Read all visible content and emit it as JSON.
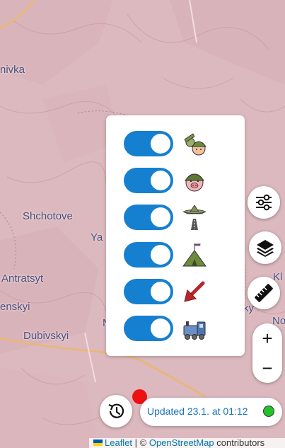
{
  "map": {
    "places": [
      "nivka",
      "Shchotove",
      "Ya",
      "Antratsyt",
      "enskyi",
      "Dubivskyi",
      "N",
      "Kl",
      "ky",
      "No"
    ]
  },
  "layer_panel": {
    "items": [
      {
        "icon": "soldiers-icon",
        "enabled": true
      },
      {
        "icon": "pig-soldier-icon",
        "enabled": true
      },
      {
        "icon": "airplane-runway-icon",
        "enabled": true
      },
      {
        "icon": "military-tent-icon",
        "enabled": true
      },
      {
        "icon": "red-arrow-icon",
        "enabled": true
      },
      {
        "icon": "train-icon",
        "enabled": true
      }
    ]
  },
  "controls": {
    "filter_icon": "sliders-icon",
    "layers_icon": "layers-icon",
    "ruler_icon": "ruler-icon",
    "zoom_in": "+",
    "zoom_out": "−",
    "history_icon": "history-icon"
  },
  "status": {
    "text": "Updated 23.1. at 01:12",
    "indicator_color": "#22c32a"
  },
  "attribution": {
    "leaflet": "Leaflet",
    "separator": " | © ",
    "osm": "OpenStreetMap",
    "contributors": " contributors"
  },
  "colors": {
    "toggle_on": "#1580d0",
    "map_bg": "#dcb9bf",
    "notification": "#ee1111"
  }
}
